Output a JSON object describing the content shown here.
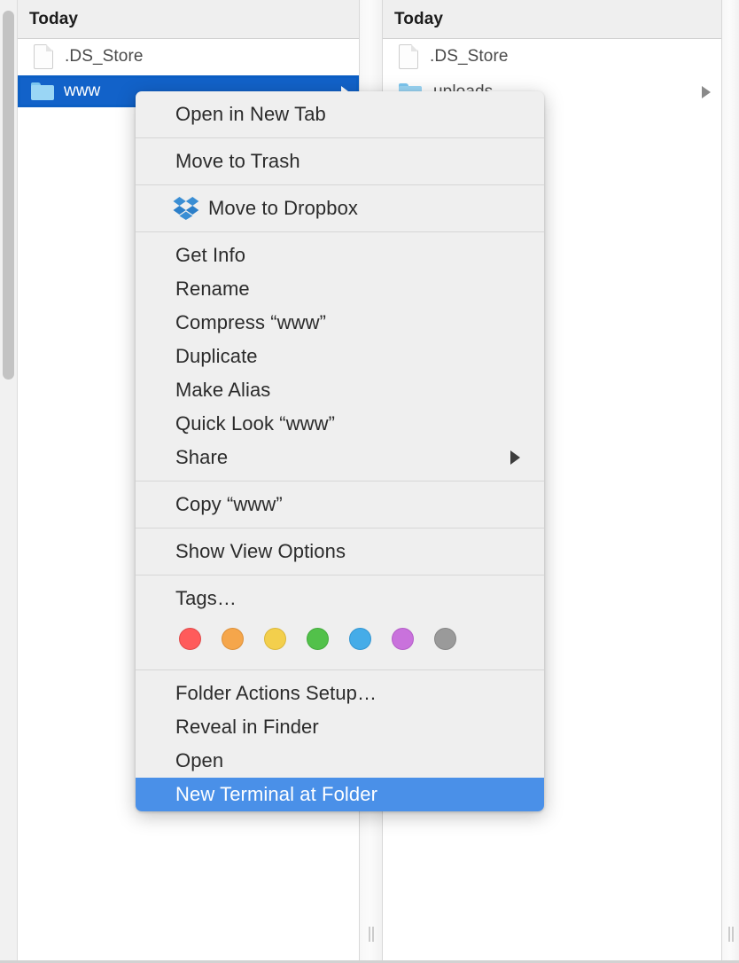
{
  "finder": {
    "columns": [
      {
        "name": "left-column",
        "header": "Today",
        "rows": [
          {
            "label": ".DS_Store",
            "icon": "document-icon",
            "selected": false,
            "has_disclosure": false
          },
          {
            "label": "www",
            "icon": "folder-icon",
            "selected": true,
            "has_disclosure": true
          }
        ]
      },
      {
        "name": "right-column",
        "header": "Today",
        "rows": [
          {
            "label": ".DS_Store",
            "icon": "document-icon",
            "selected": false,
            "has_disclosure": false
          },
          {
            "label": "uploads",
            "icon": "folder-icon",
            "selected": false,
            "has_disclosure": true
          }
        ]
      }
    ]
  },
  "context_menu": {
    "selected_item": "New Terminal at Folder",
    "highlight_color": "#4a90e8",
    "groups": [
      {
        "items": [
          {
            "label": "Open in New Tab",
            "icon": null,
            "submenu": false,
            "selected": false
          }
        ]
      },
      {
        "items": [
          {
            "label": "Move to Trash",
            "icon": null,
            "submenu": false,
            "selected": false
          }
        ]
      },
      {
        "items": [
          {
            "label": "Move to Dropbox",
            "icon": "dropbox-icon",
            "submenu": false,
            "selected": false
          }
        ]
      },
      {
        "items": [
          {
            "label": "Get Info",
            "icon": null,
            "submenu": false,
            "selected": false
          },
          {
            "label": "Rename",
            "icon": null,
            "submenu": false,
            "selected": false
          },
          {
            "label": "Compress “www”",
            "icon": null,
            "submenu": false,
            "selected": false
          },
          {
            "label": "Duplicate",
            "icon": null,
            "submenu": false,
            "selected": false
          },
          {
            "label": "Make Alias",
            "icon": null,
            "submenu": false,
            "selected": false
          },
          {
            "label": "Quick Look “www”",
            "icon": null,
            "submenu": false,
            "selected": false
          },
          {
            "label": "Share",
            "icon": null,
            "submenu": true,
            "selected": false
          }
        ]
      },
      {
        "items": [
          {
            "label": "Copy “www”",
            "icon": null,
            "submenu": false,
            "selected": false
          }
        ]
      },
      {
        "items": [
          {
            "label": "Show View Options",
            "icon": null,
            "submenu": false,
            "selected": false
          }
        ]
      },
      {
        "items": [
          {
            "label": "Tags…",
            "icon": null,
            "submenu": false,
            "selected": false
          }
        ]
      },
      {
        "items": [
          {
            "label": "Folder Actions Setup…",
            "icon": null,
            "submenu": false,
            "selected": false
          },
          {
            "label": "Reveal in Finder",
            "icon": null,
            "submenu": false,
            "selected": false
          },
          {
            "label": "Open",
            "icon": null,
            "submenu": false,
            "selected": false
          },
          {
            "label": "New Terminal at Folder",
            "icon": null,
            "submenu": false,
            "selected": true
          }
        ]
      }
    ],
    "tags": {
      "label": "Tags…",
      "swatches": [
        {
          "name": "red",
          "fill": "#ff5b5b",
          "border": "#e04a4a"
        },
        {
          "name": "orange",
          "fill": "#f5a64b",
          "border": "#dd9039"
        },
        {
          "name": "yellow",
          "fill": "#f3cf4c",
          "border": "#dbb83b"
        },
        {
          "name": "green",
          "fill": "#52c14a",
          "border": "#43ab3c"
        },
        {
          "name": "blue",
          "fill": "#45ace8",
          "border": "#3396d2"
        },
        {
          "name": "purple",
          "fill": "#c972dc",
          "border": "#b45ec8"
        },
        {
          "name": "gray",
          "fill": "#9a9a9a",
          "border": "#868686"
        }
      ]
    }
  }
}
